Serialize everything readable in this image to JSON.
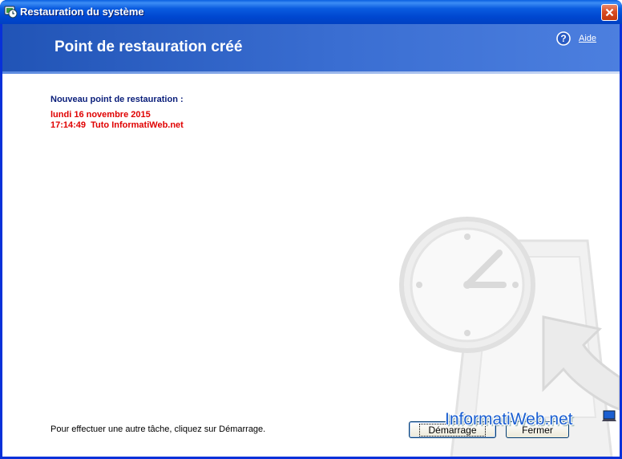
{
  "window": {
    "title": "Restauration du système",
    "close_icon": "close-icon",
    "app_icon": "system-restore-icon"
  },
  "header": {
    "title": "Point de restauration créé",
    "help_label": "Aide",
    "help_icon": "help-icon"
  },
  "restore_point": {
    "label": "Nouveau point de restauration :",
    "date": "lundi 16 novembre 2015",
    "time_and_name": "17:14:49  Tuto InformatiWeb.net"
  },
  "footer": {
    "instruction": "Pour effectuer une autre tâche, cliquez sur Démarrage.",
    "start_button": "Démarrage",
    "close_button": "Fermer"
  },
  "branding": {
    "text": "InformatiWeb.net"
  },
  "colors": {
    "titlebar": "#0a5ce0",
    "header": "#2f63c6",
    "label_blue": "#0a1e7a",
    "highlight_red": "#e00000"
  }
}
